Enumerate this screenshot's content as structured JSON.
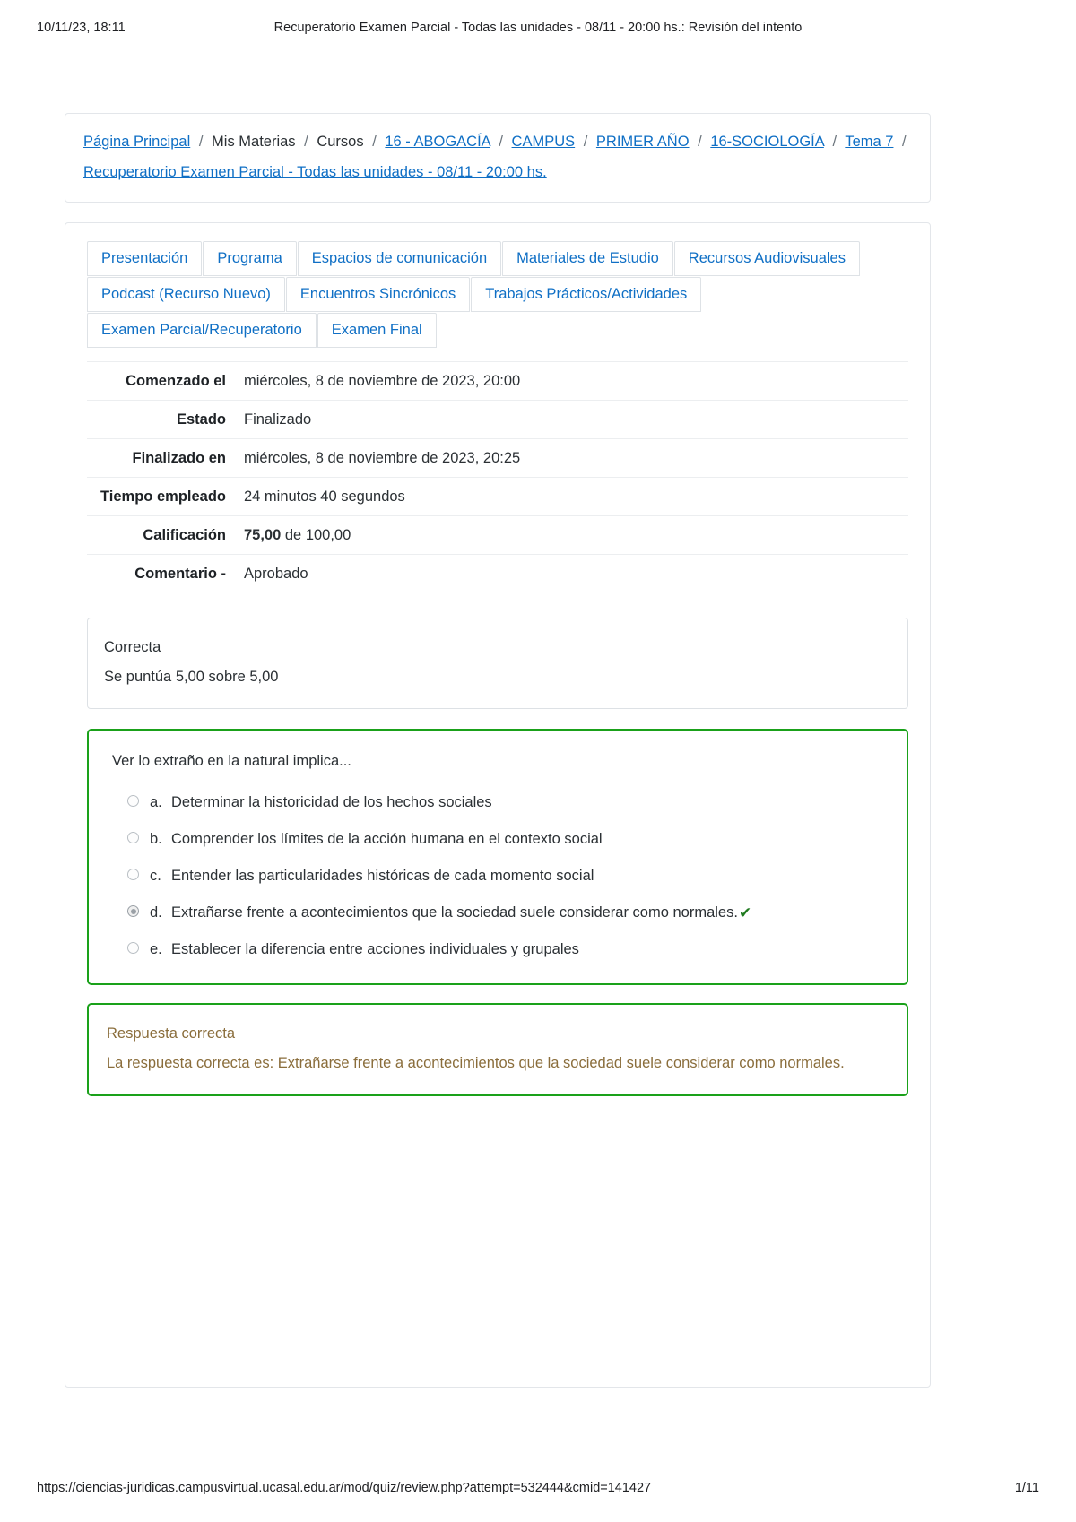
{
  "print_header": {
    "date": "10/11/23, 18:11",
    "title": "Recuperatorio Examen Parcial - Todas las unidades - 08/11 - 20:00 hs.: Revisión del intento"
  },
  "print_footer": {
    "url": "https://ciencias-juridicas.campusvirtual.ucasal.edu.ar/mod/quiz/review.php?attempt=532444&cmid=141427",
    "page": "1/11"
  },
  "breadcrumb": {
    "separator": "/",
    "items": [
      {
        "label": "Página Principal",
        "link": true
      },
      {
        "label": "Mis Materias",
        "link": false
      },
      {
        "label": "Cursos",
        "link": false
      },
      {
        "label": "16 - ABOGACÍA",
        "link": true
      },
      {
        "label": "CAMPUS",
        "link": true
      },
      {
        "label": "PRIMER AÑO",
        "link": true
      },
      {
        "label": "16-SOCIOLOGÍA",
        "link": true
      },
      {
        "label": "Tema 7",
        "link": true
      },
      {
        "label": "Recuperatorio Examen Parcial - Todas las unidades - 08/11 - 20:00 hs.",
        "link": true
      }
    ]
  },
  "tabs": [
    {
      "label": "Presentación"
    },
    {
      "label": "Programa"
    },
    {
      "label": "Espacios de comunicación"
    },
    {
      "label": "Materiales de Estudio"
    },
    {
      "label": "Recursos Audiovisuales"
    },
    {
      "label": "Podcast (Recurso Nuevo)"
    },
    {
      "label": "Encuentros Sincrónicos"
    },
    {
      "label": "Trabajos Prácticos/Actividades"
    },
    {
      "label": "Examen Parcial/Recuperatorio"
    },
    {
      "label": "Examen Final"
    }
  ],
  "attempt_info": {
    "rows": [
      {
        "label": "Comenzado el",
        "value": "miércoles, 8 de noviembre de 2023, 20:00"
      },
      {
        "label": "Estado",
        "value": "Finalizado"
      },
      {
        "label": "Finalizado en",
        "value": "miércoles, 8 de noviembre de 2023, 20:25"
      },
      {
        "label": "Tiempo empleado",
        "value": "24 minutos 40 segundos"
      },
      {
        "label": "Calificación",
        "value_strong": "75,00",
        "value_rest": " de 100,00"
      },
      {
        "label": "Comentario -",
        "value": "Aprobado"
      }
    ]
  },
  "question_status": {
    "state": "Correcta",
    "marks": "Se puntúa 5,00 sobre 5,00"
  },
  "question": {
    "text": "Ver lo extraño en la natural implica...",
    "options": [
      {
        "letter": "a.",
        "text": "Determinar la historicidad de los hechos sociales",
        "selected": false,
        "correct": false
      },
      {
        "letter": "b.",
        "text": "Comprender los límites de la acción humana en el contexto social",
        "selected": false,
        "correct": false
      },
      {
        "letter": "c.",
        "text": "Entender las particularidades históricas de cada momento social",
        "selected": false,
        "correct": false
      },
      {
        "letter": "d.",
        "text": "Extrañarse frente a acontecimientos que la sociedad suele considerar como normales.",
        "selected": true,
        "correct": true
      },
      {
        "letter": "e.",
        "text": "Establecer la diferencia entre acciones individuales y grupales",
        "selected": false,
        "correct": false
      }
    ],
    "correct_mark_glyph": "✔"
  },
  "feedback": {
    "title": "Respuesta correcta",
    "body": "La respuesta correcta es: Extrañarse frente a acontecimientos que la sociedad suele considerar como normales."
  },
  "colors": {
    "link": "#0f6fc5",
    "correct_border": "#1aa11a",
    "feedback_text": "#8a6d3b",
    "check_green": "#1f7a1f"
  }
}
